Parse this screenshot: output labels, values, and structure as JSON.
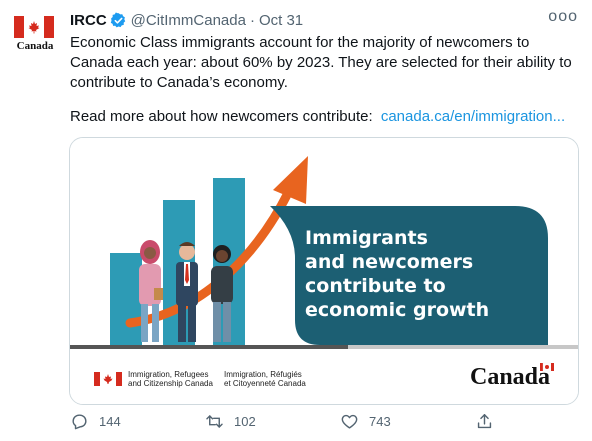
{
  "tweet": {
    "author_name": "IRCC",
    "handle": "@CitImmCanada",
    "separator": "·",
    "date": "Oct 31",
    "more_label": "ooo",
    "body": "Economic Class immigrants account for the majority of newcomers to Canada each year: about 60% by 2023. They are selected for their ability to contribute to Canada’s economy.",
    "read_more_text": "Read more about how newcomers contribute:",
    "link_text": "canada.ca/en/immigration...",
    "avatar_wordmark": "Canada",
    "icons": {
      "verified": "verified-badge-icon",
      "more": "more-options-icon",
      "reply": "reply-icon",
      "retweet": "retweet-icon",
      "like": "heart-icon",
      "share": "share-icon"
    }
  },
  "card": {
    "headline_line1": "Immigrants",
    "headline_line2": "and newcomers",
    "headline_line3": "contribute to",
    "headline_line4": "economic growth",
    "dept_en_line1": "Immigration, Refugees",
    "dept_en_line2": "and Citizenship Canada",
    "dept_fr_line1": "Immigration, Réfugiés",
    "dept_fr_line2": "et Citoyenneté Canada",
    "wordmark": "Canada",
    "colors": {
      "teal": "#1c5f73",
      "bars": "#2d9bb5",
      "arrow": "#e8641f",
      "flag_red": "#d52b1e"
    }
  },
  "actions": {
    "replies": "144",
    "retweets": "102",
    "likes": "743"
  }
}
